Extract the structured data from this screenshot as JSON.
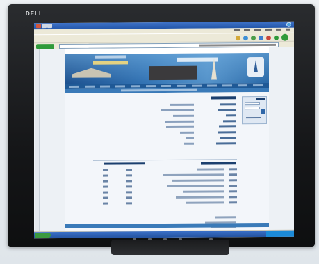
{
  "monitor": {
    "brand": "DELL"
  },
  "colors": {
    "bezel": "#151618",
    "xp_title": "#2457aa",
    "page_header": "#1f5996",
    "page_bg": "#f3f6fa"
  },
  "icons": [
    "internet-explorer-icon",
    "window-close-icon",
    "search-icon",
    "favorites-star-icon",
    "home-icon",
    "refresh-icon",
    "go-arrow-icon",
    "start-button-icon"
  ]
}
